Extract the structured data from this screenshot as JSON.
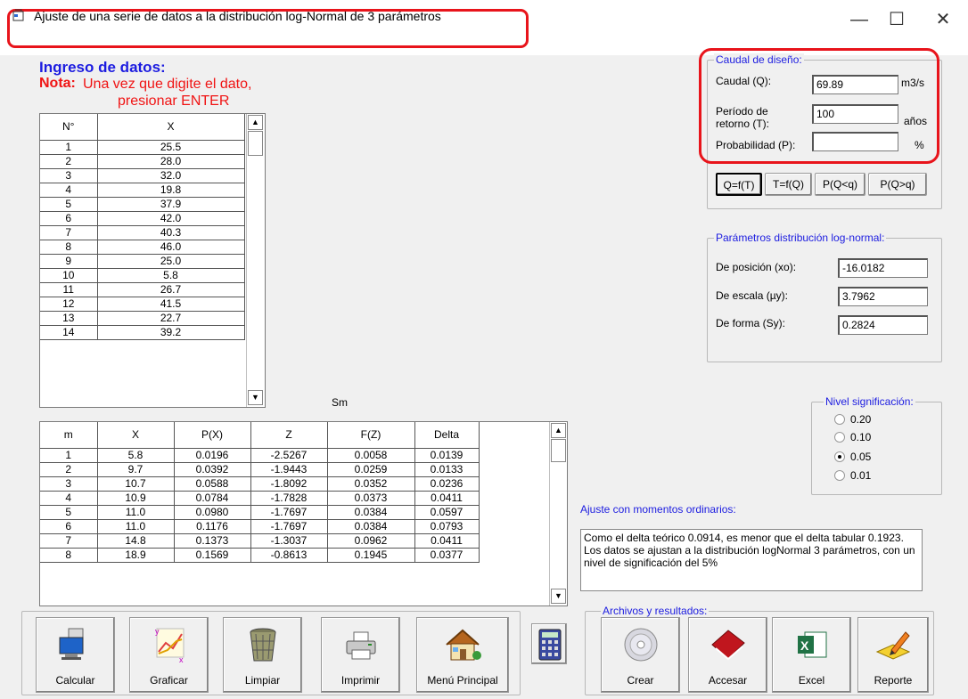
{
  "window": {
    "title": "Ajuste de una serie de datos a la distribución log-Normal de 3 parámetros",
    "minimize": "—",
    "maximize": "☐",
    "close": "✕"
  },
  "input": {
    "heading": "Ingreso de datos:",
    "note_label": "Nota:",
    "note_text": "Una vez que digite el dato,",
    "note_text2": "presionar ENTER",
    "columns": [
      "N°",
      "X"
    ],
    "rows": [
      [
        "1",
        "25.5"
      ],
      [
        "2",
        "28.0"
      ],
      [
        "3",
        "32.0"
      ],
      [
        "4",
        "19.8"
      ],
      [
        "5",
        "37.9"
      ],
      [
        "6",
        "42.0"
      ],
      [
        "7",
        "40.3"
      ],
      [
        "8",
        "46.0"
      ],
      [
        "9",
        "25.0"
      ],
      [
        "10",
        "5.8"
      ],
      [
        "11",
        "26.7"
      ],
      [
        "12",
        "41.5"
      ],
      [
        "13",
        "22.7"
      ],
      [
        "14",
        "39.2"
      ]
    ]
  },
  "sm_label": "Sm",
  "results_table": {
    "columns": [
      "m",
      "X",
      "P(X)",
      "Z",
      "F(Z)",
      "Delta"
    ],
    "rows": [
      [
        "1",
        "5.8",
        "0.0196",
        "-2.5267",
        "0.0058",
        "0.0139"
      ],
      [
        "2",
        "9.7",
        "0.0392",
        "-1.9443",
        "0.0259",
        "0.0133"
      ],
      [
        "3",
        "10.7",
        "0.0588",
        "-1.8092",
        "0.0352",
        "0.0236"
      ],
      [
        "4",
        "10.9",
        "0.0784",
        "-1.7828",
        "0.0373",
        "0.0411"
      ],
      [
        "5",
        "11.0",
        "0.0980",
        "-1.7697",
        "0.0384",
        "0.0597"
      ],
      [
        "6",
        "11.0",
        "0.1176",
        "-1.7697",
        "0.0384",
        "0.0793"
      ],
      [
        "7",
        "14.8",
        "0.1373",
        "-1.3037",
        "0.0962",
        "0.0411"
      ],
      [
        "8",
        "18.9",
        "0.1569",
        "-0.8613",
        "0.1945",
        "0.0377"
      ]
    ]
  },
  "design": {
    "legend": "Caudal de diseño:",
    "caudal_label": "Caudal (Q):",
    "caudal_value": "69.89",
    "caudal_unit": "m3/s",
    "periodo_label1": "Período de",
    "periodo_label2": "retorno (T):",
    "periodo_value": "100",
    "periodo_unit": "años",
    "prob_label": "Probabilidad (P):",
    "prob_value": "",
    "prob_unit": "%",
    "buttons": [
      "Q=f(T)",
      "T=f(Q)",
      "P(Q<q)",
      "P(Q>q)"
    ]
  },
  "params": {
    "legend": "Parámetros distribución log-normal:",
    "pos_label": "De posición (xo):",
    "pos_value": "-16.0182",
    "esc_label": "De escala (µy):",
    "esc_value": "3.7962",
    "forma_label": "De forma (Sy):",
    "forma_value": "0.2824"
  },
  "significance": {
    "legend": "Nivel significación:",
    "options": [
      "0.20",
      "0.10",
      "0.05",
      "0.01"
    ],
    "selected": "0.05"
  },
  "fit": {
    "label": "Ajuste con momentos ordinarios:",
    "text": "Como el delta teórico 0.0914, es menor que el delta tabular 0.1923. Los datos se ajustan a la distribución logNormal 3 parámetros, con un nivel de significación del 5%"
  },
  "actions": {
    "calcular": "Calcular",
    "graficar": "Graficar",
    "limpiar": "Limpiar",
    "imprimir": "Imprimir",
    "menu": "Menú Principal"
  },
  "files": {
    "legend": "Archivos y resultados:",
    "crear": "Crear",
    "accesar": "Accesar",
    "excel": "Excel",
    "reporte": "Reporte"
  }
}
